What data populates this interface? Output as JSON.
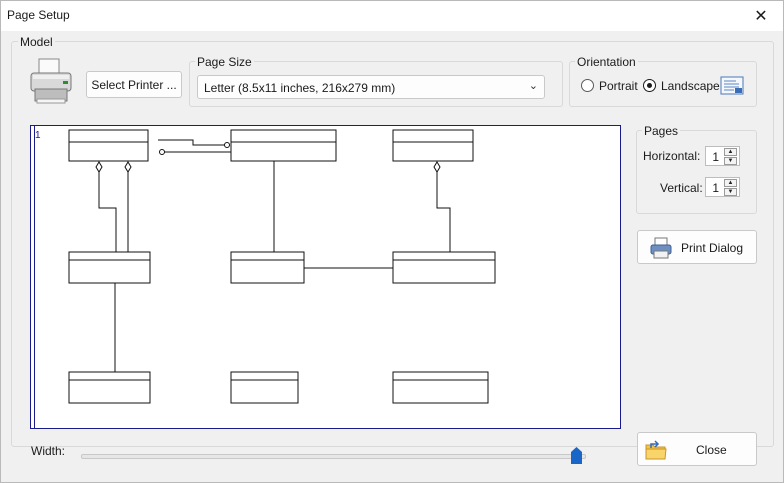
{
  "window": {
    "title": "Page Setup",
    "close_glyph": "✕"
  },
  "model": {
    "legend": "Model",
    "select_printer_label": "Select Printer ..."
  },
  "page_size": {
    "legend": "Page Size",
    "selected": "Letter (8.5x11 inches, 216x279 mm)"
  },
  "orientation": {
    "legend": "Orientation",
    "portrait_label": "Portrait",
    "landscape_label": "Landscape",
    "selected": "Landscape"
  },
  "pages": {
    "legend": "Pages",
    "horizontal_label": "Horizontal:",
    "horizontal_value": "1",
    "vertical_label": "Vertical:",
    "vertical_value": "1"
  },
  "print_dialog_label": "Print Dialog",
  "close_label": "Close",
  "preview": {
    "page_number": "1"
  },
  "width": {
    "label": "Width:",
    "level_percent": 100
  },
  "icons": {
    "printer": "printer-icon",
    "landscape": "landscape-page-icon",
    "print_dialog": "print-dialog-icon",
    "close": "folder-close-icon",
    "spin_up": "▲",
    "spin_down": "▼",
    "chevron": "⌄"
  },
  "colors": {
    "preview_border": "#1a1a8a",
    "slider_thumb": "#1766c8"
  }
}
